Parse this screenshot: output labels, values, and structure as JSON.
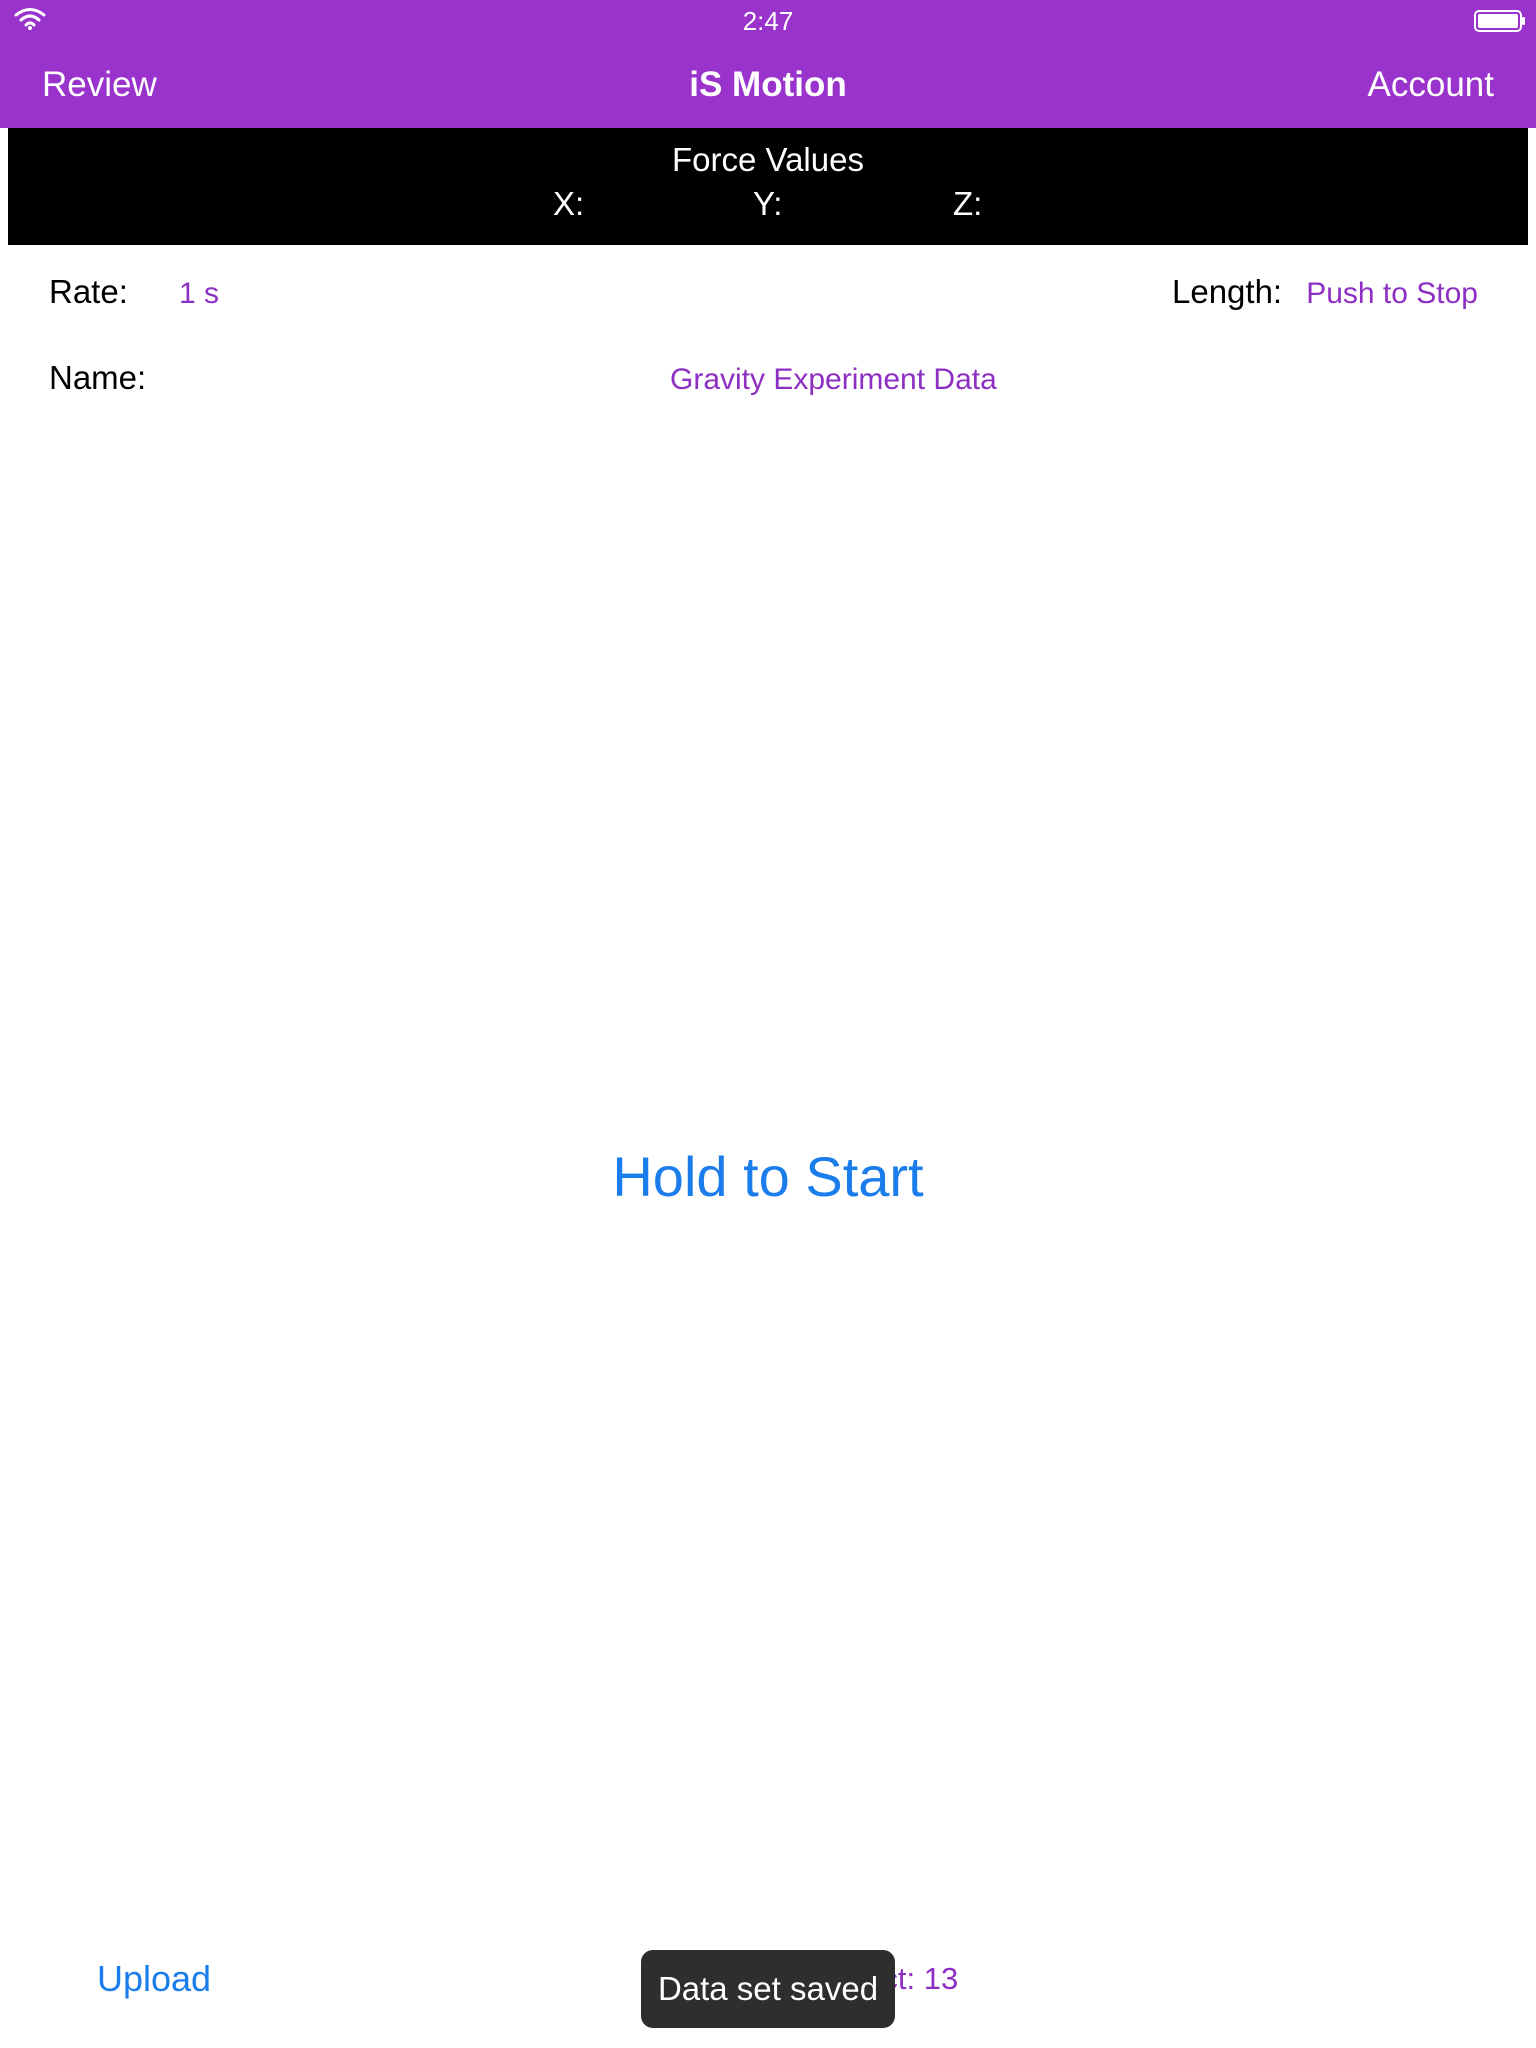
{
  "status_bar": {
    "time": "2:47"
  },
  "nav": {
    "left_label": "Review",
    "title": "iS Motion",
    "right_label": "Account"
  },
  "force_panel": {
    "title": "Force Values",
    "x_label": "X:",
    "y_label": "Y:",
    "z_label": "Z:"
  },
  "settings": {
    "rate_label": "Rate:",
    "rate_value": "1 s",
    "length_label": "Length:",
    "length_value": "Push to Stop",
    "name_label": "Name:",
    "name_value": "Gravity Experiment Data"
  },
  "main": {
    "start_label": "Hold to Start"
  },
  "bottom": {
    "upload_label": "Upload",
    "project_text": "Project: 13"
  },
  "toast": {
    "message": "Data set saved"
  },
  "colors": {
    "header": "#9A33CC",
    "accent_purple": "#8E2FC4",
    "action_blue": "#1A7DEB",
    "force_panel": "#000000",
    "toast": "#2E2E2E"
  },
  "icons": {
    "wifi": "wifi-icon",
    "battery": "battery-icon"
  }
}
